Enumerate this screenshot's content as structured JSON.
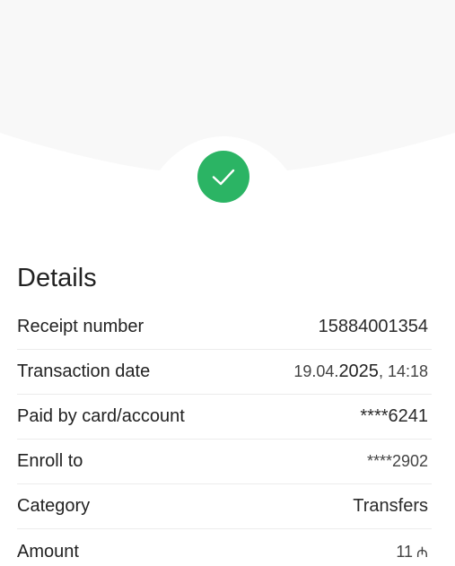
{
  "section_title": "Details",
  "rows": [
    {
      "label": "Receipt number",
      "value": "15884001354"
    },
    {
      "label": "Transaction date",
      "date_prefix": "19.04.",
      "date_year": "2025",
      "date_sep": ", ",
      "time": "14:18"
    },
    {
      "label": "Paid by card/account",
      "value": "****6241"
    },
    {
      "label": "Enroll to",
      "value": "****2902"
    },
    {
      "label": "Category",
      "value": "Transfers"
    },
    {
      "label": "Amount",
      "value": "11",
      "currency": "₼"
    }
  ],
  "colors": {
    "success": "#2bb464",
    "header_bg": "#f8f8f8"
  },
  "icons": {
    "status": "checkmark-icon"
  }
}
